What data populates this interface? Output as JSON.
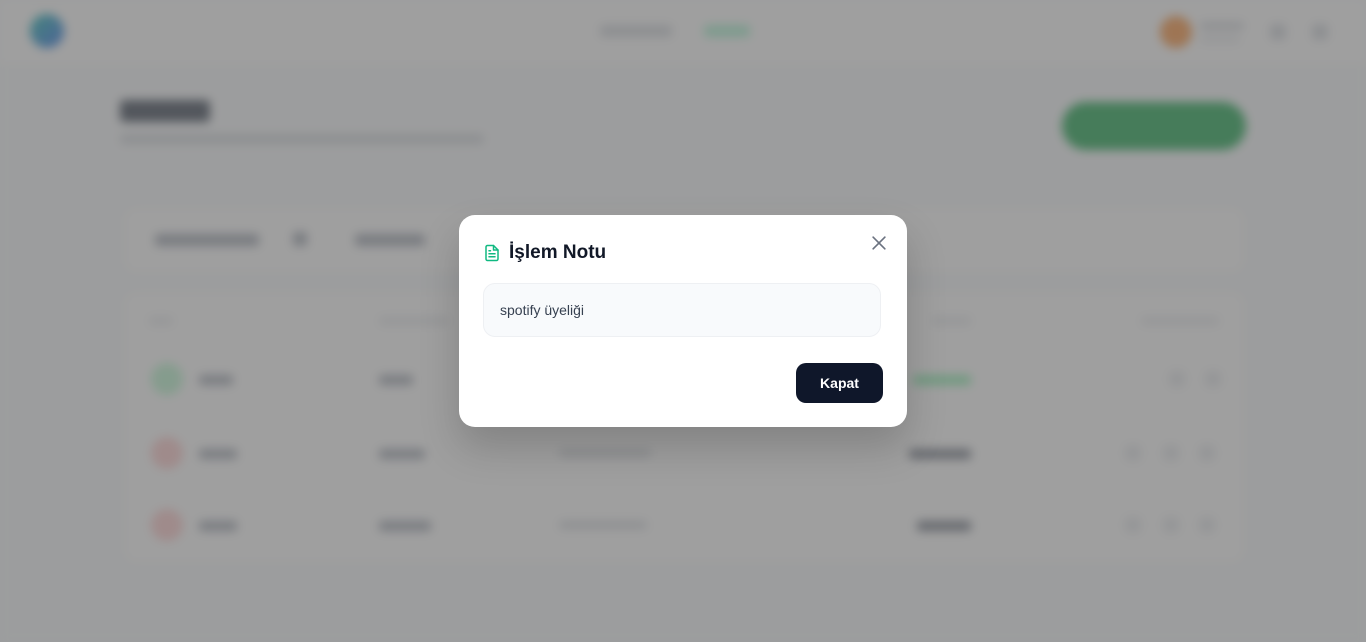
{
  "modal": {
    "title": "İşlem Notu",
    "icon": "file-text-icon",
    "note": "spotify üyeliği",
    "close_button_label": "Kapat",
    "close_icon": "close-icon",
    "accent_color": "#10b981"
  },
  "colors": {
    "overlay": "#646464",
    "primary_button": "#0f172a",
    "new_transaction_button": "#16a34a"
  }
}
